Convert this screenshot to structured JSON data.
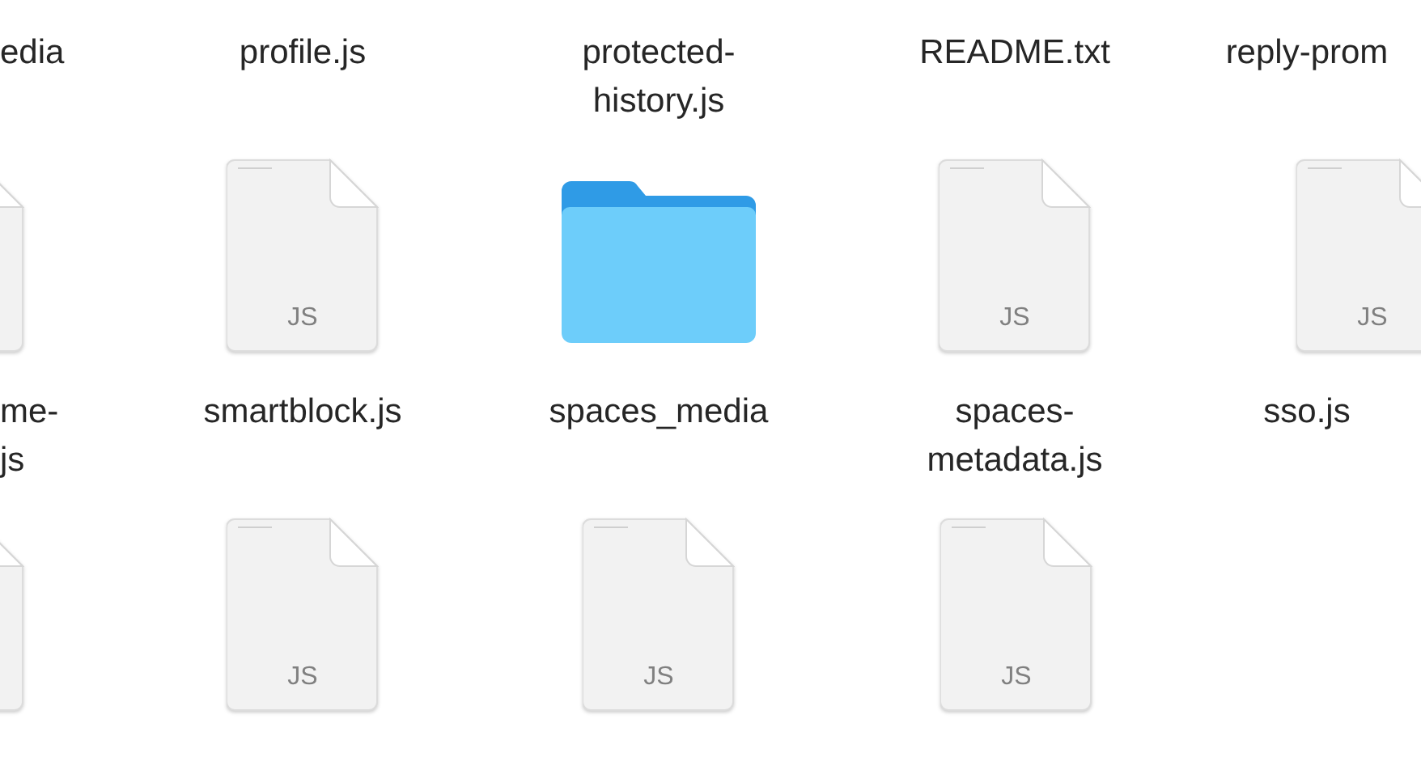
{
  "rows": [
    {
      "items": [
        {
          "label_lines": [
            "edia"
          ]
        },
        {
          "label_lines": [
            "profile.js"
          ]
        },
        {
          "label_lines": [
            "protected-",
            "history.js"
          ]
        },
        {
          "label_lines": [
            "README.txt"
          ]
        },
        {
          "label_lines": [
            "reply-prom"
          ]
        }
      ]
    },
    {
      "items": [
        {
          "kind": "js",
          "label_lines": [
            "me-",
            "js"
          ]
        },
        {
          "kind": "js",
          "type_label": "JS",
          "label_lines": [
            "smartblock.js"
          ]
        },
        {
          "kind": "folder",
          "label_lines": [
            "spaces_media"
          ]
        },
        {
          "kind": "js",
          "type_label": "JS",
          "label_lines": [
            "spaces-",
            "metadata.js"
          ]
        },
        {
          "kind": "js",
          "type_label": "JS",
          "label_lines": [
            "sso.js"
          ]
        }
      ]
    },
    {
      "items": [
        {
          "kind": "js"
        },
        {
          "kind": "js",
          "type_label": "JS"
        },
        {
          "kind": "js",
          "type_label": "JS"
        },
        {
          "kind": "js",
          "type_label": "JS"
        }
      ]
    }
  ]
}
